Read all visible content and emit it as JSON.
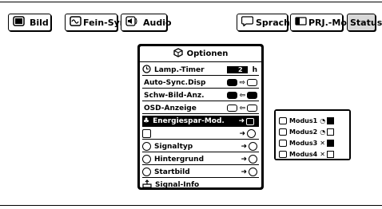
{
  "tabs": [
    {
      "label": "Bild",
      "icon": "picture-icon"
    },
    {
      "label": "Fein-Sync.",
      "icon": "sync-icon"
    },
    {
      "label": "Audio",
      "icon": "speaker-icon"
    },
    {
      "label": "Sprache",
      "icon": "speech-bubble-icon"
    },
    {
      "label": "PRJ.-Mode",
      "icon": "projector-icon"
    },
    {
      "label": "Status",
      "icon": ""
    }
  ],
  "menu": {
    "title": "Optionen",
    "items": [
      {
        "label": "Lamp.-Timer",
        "value": "2",
        "unit": "h"
      },
      {
        "label": "Auto-Sync.Disp"
      },
      {
        "label": "Schw-Bild-Anz."
      },
      {
        "label": "OSD-Anzeige"
      },
      {
        "label": "Energiespar-Mod."
      },
      {
        "label": ""
      },
      {
        "label": "Signaltyp"
      },
      {
        "label": "Hintergrund"
      },
      {
        "label": "Startbild"
      },
      {
        "label": "Signal-Info"
      }
    ]
  },
  "submenu": {
    "items": [
      {
        "label": "Modus1"
      },
      {
        "label": "Modus2"
      },
      {
        "label": "Modus3"
      },
      {
        "label": "Modus4"
      }
    ]
  }
}
